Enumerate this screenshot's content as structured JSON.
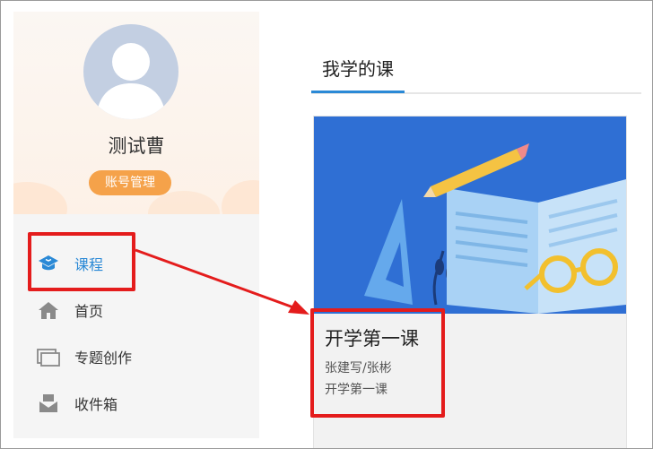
{
  "profile": {
    "name": "测试曹",
    "account_button": "账号管理"
  },
  "nav": {
    "items": [
      {
        "label": "课程",
        "icon": "graduation-cap-icon",
        "active": true
      },
      {
        "label": "首页",
        "icon": "home-icon"
      },
      {
        "label": "专题创作",
        "icon": "windows-icon"
      },
      {
        "label": "收件箱",
        "icon": "inbox-mail-icon"
      }
    ]
  },
  "main": {
    "tab": "我学的课",
    "course": {
      "title": "开学第一课",
      "teacher": "张建写/张彬",
      "subtitle": "开学第一课"
    }
  },
  "colors": {
    "accent": "#2a89d6",
    "orange_button": "#f5a24a",
    "annotation_red": "#e41c1c",
    "cover_blue": "#2f6fd4"
  }
}
